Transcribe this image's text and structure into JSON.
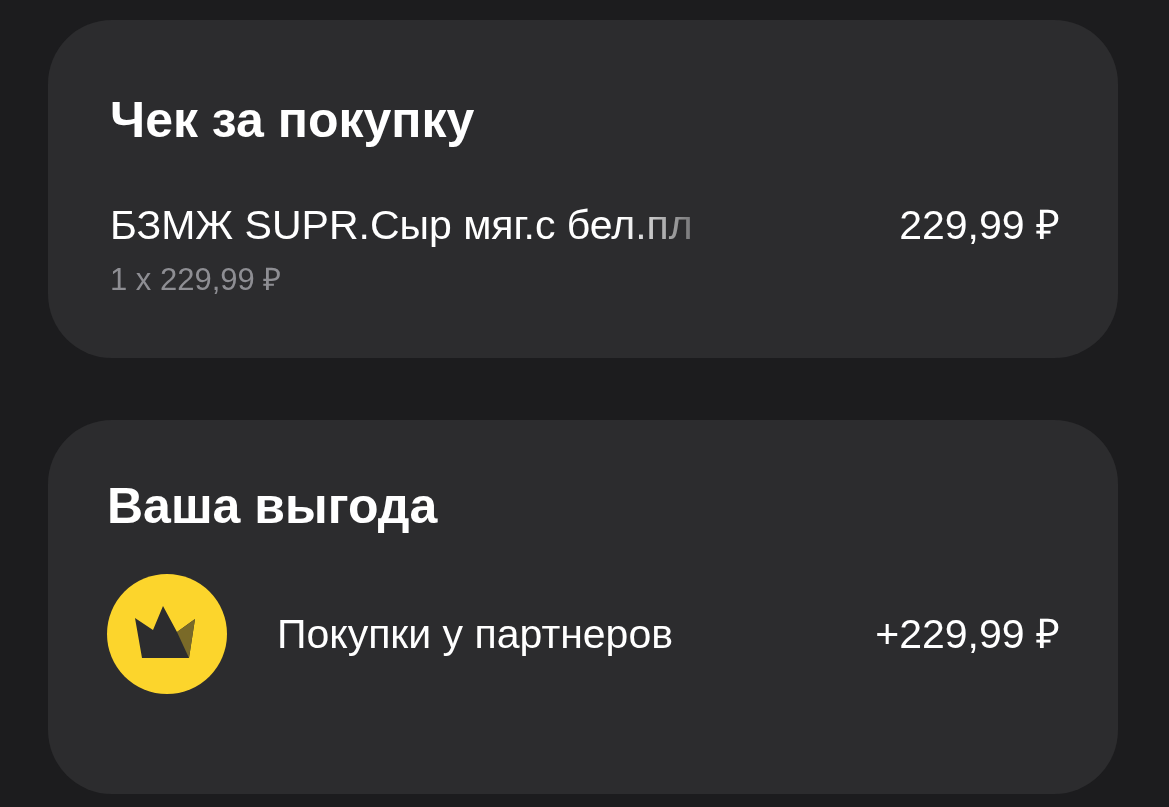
{
  "receipt": {
    "title": "Чек за покупку",
    "items": [
      {
        "name": "БЗМЖ SUPR.Сыр мяг.с бел.пл",
        "price": "229,99 ₽",
        "quantity_line": "1 x 229,99 ₽"
      }
    ]
  },
  "benefit": {
    "title": "Ваша выгода",
    "rows": [
      {
        "label": "Покупки у партнеров",
        "amount": "+229,99 ₽"
      }
    ]
  }
}
